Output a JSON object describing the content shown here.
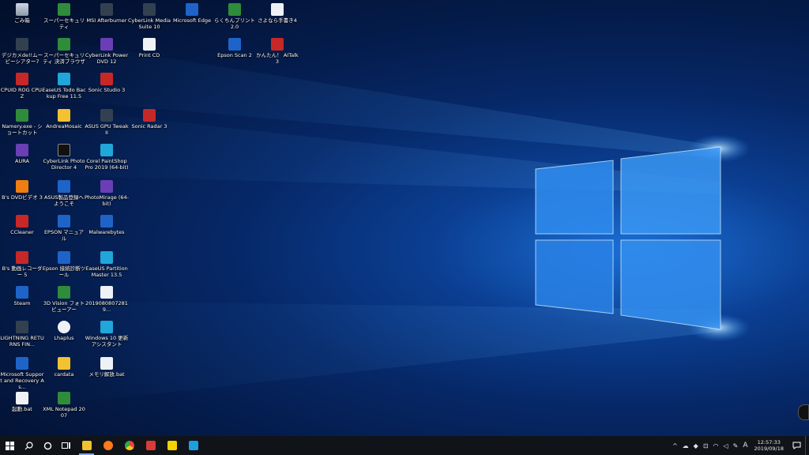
{
  "desktop": {
    "icons": [
      {
        "label": "ごみ箱",
        "icon": "recycle-bin-icon"
      },
      {
        "label": "スーパーセキュリティ",
        "icon": "security-icon"
      },
      {
        "label": "MSI Afterburner",
        "icon": "afterburner-icon"
      },
      {
        "label": "CyberLink Media Suite 10",
        "icon": "media-suite-icon"
      },
      {
        "label": "Microsoft Edge",
        "icon": "edge-icon"
      },
      {
        "label": "らくちんプリント2.0",
        "icon": "print-app-icon"
      },
      {
        "label": "さよなら手書き4",
        "icon": "document-app-icon"
      },
      {
        "label": "デジカメde!!ムービーシアター7",
        "icon": "movie-theater-icon"
      },
      {
        "label": "スーパーセキュリティ 決済ブラウザ",
        "icon": "security-browser-icon"
      },
      {
        "label": "CyberLink PowerDVD 12",
        "icon": "powerdvd-icon"
      },
      {
        "label": "Print CD",
        "icon": "print-cd-icon"
      },
      {
        "label": "Epson Scan 2",
        "icon": "scanner-icon"
      },
      {
        "label": "かんたん！ AITalk 3",
        "icon": "aitalk-icon"
      },
      {
        "label": "CPUID ROG CPU-Z",
        "icon": "cpuz-icon"
      },
      {
        "label": "EaseUS Todo Backup Free 11.5",
        "icon": "backup-icon"
      },
      {
        "label": "Sonic Studio 3",
        "icon": "sonic-studio-icon"
      },
      {
        "label": "Namery.exe - ショートカット",
        "icon": "shortcut-icon"
      },
      {
        "label": "AndreaMosaic",
        "icon": "mosaic-icon"
      },
      {
        "label": "ASUS GPU TweakII",
        "icon": "gpu-tweak-icon"
      },
      {
        "label": "Sonic Radar 3",
        "icon": "sonic-radar-icon"
      },
      {
        "label": "AURA",
        "icon": "aura-icon"
      },
      {
        "label": "CyberLink PhotoDirector 4",
        "icon": "photodirector-icon"
      },
      {
        "label": "Corel PaintShop Pro 2019 (64-bit)",
        "icon": "paintshop-icon"
      },
      {
        "label": "B's DVDビデオ 3",
        "icon": "dvd-video-icon"
      },
      {
        "label": "ASUS製品登録へようこそ",
        "icon": "asus-register-icon"
      },
      {
        "label": "PhotoMirage (64-bit)",
        "icon": "photomirage-icon"
      },
      {
        "label": "CCleaner",
        "icon": "ccleaner-icon"
      },
      {
        "label": "EPSON マニュアル",
        "icon": "epson-manual-icon"
      },
      {
        "label": "Malwarebytes",
        "icon": "malwarebytes-icon"
      },
      {
        "label": "B's 動画レコーダー 5",
        "icon": "video-recorder-icon"
      },
      {
        "label": "Epson 接続診断ツール",
        "icon": "epson-diagnostic-icon"
      },
      {
        "label": "EaseUS Partition Master 13.5",
        "icon": "partition-icon"
      },
      {
        "label": "Steam",
        "icon": "steam-icon"
      },
      {
        "label": "3D Vision フォトビューアー",
        "icon": "3d-vision-icon"
      },
      {
        "label": "2019080807281 9...",
        "icon": "file-icon"
      },
      {
        "label": "LIGHTNING RETURNS FIN...",
        "icon": "game-icon"
      },
      {
        "label": "Lhaplus",
        "icon": "lhaplus-icon"
      },
      {
        "label": "Windows 10 更新 アシスタント",
        "icon": "windows-update-icon"
      },
      {
        "label": "Microsoft Support and Recovery As...",
        "icon": "support-icon"
      },
      {
        "label": "cardata",
        "icon": "folder-icon"
      },
      {
        "label": "メモリ解放.bat",
        "icon": "bat-file-icon"
      },
      {
        "label": "起動.bat",
        "icon": "bat-file-icon"
      },
      {
        "label": "XML Notepad 2007",
        "icon": "xml-notepad-icon"
      }
    ]
  },
  "taskbar": {
    "start": "start-icon",
    "search": "search-icon",
    "cortana": "cortana-icon",
    "taskview": "task-view-icon",
    "apps": [
      {
        "name": "file-explorer",
        "color": "#f2c230",
        "active": true
      },
      {
        "name": "firefox",
        "color": "#ff7a1a",
        "active": false
      },
      {
        "name": "chrome",
        "color": "#e8453c",
        "active": false
      },
      {
        "name": "app-red",
        "color": "#d93b36",
        "active": false
      },
      {
        "name": "sticky-notes",
        "color": "#f5d300",
        "active": false
      },
      {
        "name": "camera-app",
        "color": "#1ba1e2",
        "active": false
      }
    ],
    "tray": {
      "ime": "A",
      "time": "12:57:33",
      "date": "2019/09/18"
    }
  }
}
